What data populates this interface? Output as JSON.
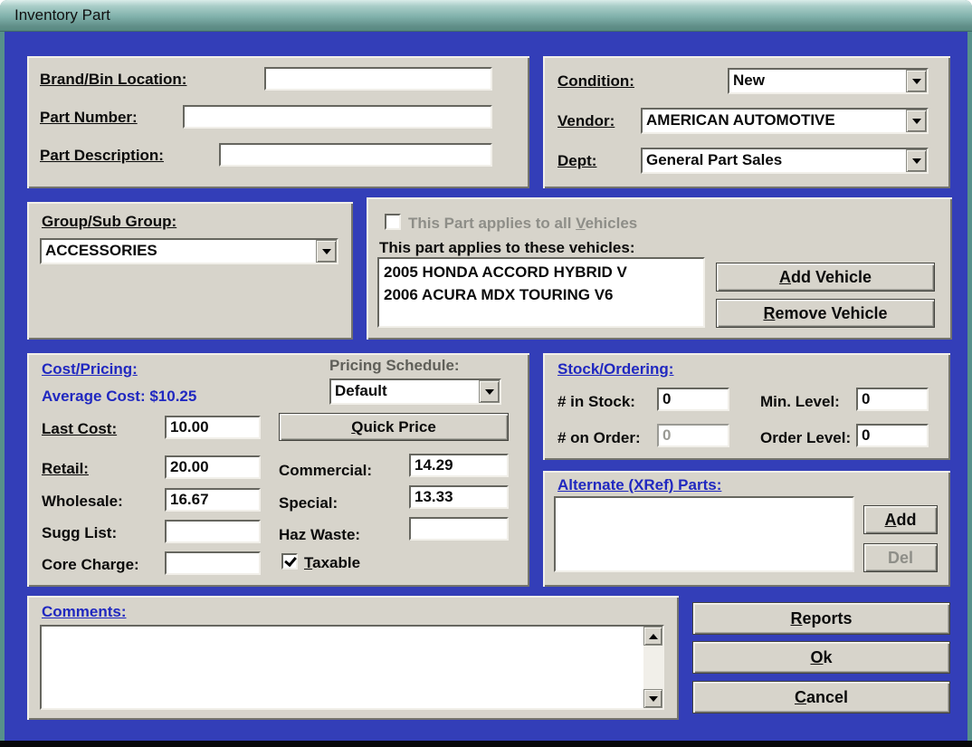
{
  "window": {
    "title": "Inventory Part"
  },
  "ident": {
    "brand_bin": {
      "label": "Brand/Bin Location:",
      "value": ""
    },
    "part_number": {
      "label": "Part Number:",
      "value": ""
    },
    "part_desc": {
      "label": "Part Description:",
      "value": ""
    }
  },
  "cls": {
    "condition": {
      "label": "Condition:",
      "value": "New"
    },
    "vendor": {
      "label": "Vendor:",
      "value": "AMERICAN AUTOMOTIVE"
    },
    "dept": {
      "label": "Dept:",
      "value": "General Part Sales"
    }
  },
  "group": {
    "label": "Group/Sub Group:",
    "value": "ACCESSORIES"
  },
  "veh": {
    "all_label": "This Part applies to all Vehicles",
    "list_label": "This part applies to these vehicles:",
    "items": [
      "2005 HONDA ACCORD HYBRID V",
      "2006 ACURA MDX TOURING V6"
    ],
    "add": "Add Vehicle",
    "remove": "Remove Vehicle"
  },
  "price": {
    "heading": "Cost/Pricing:",
    "avg": "Average Cost: $10.25",
    "sched_label": "Pricing Schedule:",
    "sched_value": "Default",
    "quick": "Quick Price",
    "last": {
      "label": "Last Cost:",
      "value": "10.00"
    },
    "retail": {
      "label": "Retail:",
      "value": "20.00"
    },
    "whole": {
      "label": "Wholesale:",
      "value": "16.67"
    },
    "sugg": {
      "label": "Sugg List:",
      "value": ""
    },
    "core": {
      "label": "Core Charge:",
      "value": ""
    },
    "comm": {
      "label": "Commercial:",
      "value": "14.29"
    },
    "special": {
      "label": "Special:",
      "value": "13.33"
    },
    "haz": {
      "label": "Haz Waste:",
      "value": ""
    },
    "taxable": "Taxable"
  },
  "stock": {
    "heading": "Stock/Ordering:",
    "in_stock": {
      "label": "# in Stock:",
      "value": "0"
    },
    "min_level": {
      "label": "Min. Level:",
      "value": "0"
    },
    "on_order": {
      "label": "# on Order:",
      "value": "0"
    },
    "order_level": {
      "label": "Order Level:",
      "value": "0"
    }
  },
  "xref": {
    "heading": "Alternate (XRef) Parts:",
    "add": "Add",
    "del": "Del"
  },
  "comments": {
    "heading": "Comments:",
    "text": ""
  },
  "actions": {
    "reports": "Reports",
    "ok": "Ok",
    "cancel": "Cancel"
  },
  "colors": {
    "dialog_blue": "#333eb8",
    "panel_gray": "#d7d4cb",
    "heading_blue": "#2028c0",
    "title_teal": "#578981"
  }
}
